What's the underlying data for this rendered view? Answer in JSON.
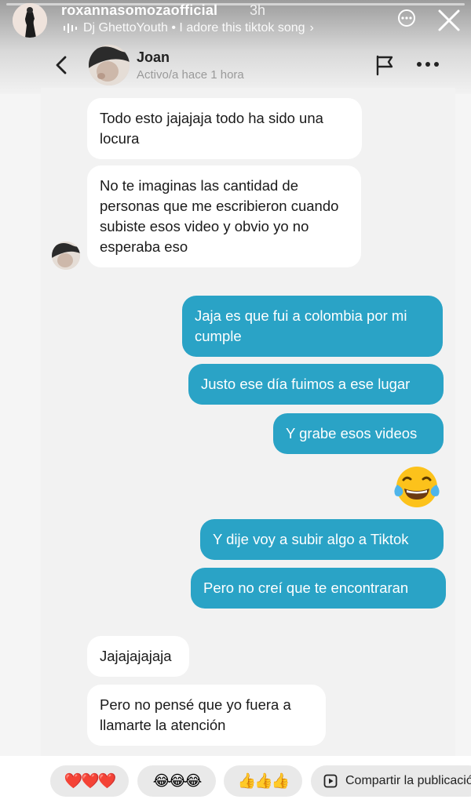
{
  "story": {
    "username": "roxannasomozaofficial",
    "time": "3h",
    "music": "Dj GhettoYouth • I adore this tiktok song",
    "progress": 0.0
  },
  "chat_header": {
    "contact_name": "Joan",
    "contact_status": "Activo/a hace 1 hora"
  },
  "messages": [
    {
      "direction": "in",
      "text": "Todo esto jajajaja todo ha sido una locura"
    },
    {
      "direction": "in",
      "text": "No te imaginas las cantidad de personas que me escribieron cuando subiste esos video y obvio yo no esperaba eso"
    },
    {
      "direction": "out",
      "text": "Jaja es que fui a colombia por mi cumple"
    },
    {
      "direction": "out",
      "text": "Justo ese día fuimos a ese lugar"
    },
    {
      "direction": "out",
      "text": "Y grabe esos videos"
    },
    {
      "direction": "out",
      "text": "😂",
      "type": "emoji",
      "emoji_name": "face-with-tears-of-joy"
    },
    {
      "direction": "out",
      "text": "Y dije voy a subir algo a Tiktok"
    },
    {
      "direction": "out",
      "text": "Pero no creí que te encontraran"
    },
    {
      "direction": "in",
      "text": "Jajajajajaja"
    },
    {
      "direction": "in",
      "text": "Pero no pensé que yo fuera a llamarte la atención"
    }
  ],
  "reactions": {
    "hearts": "❤️❤️❤️",
    "laughs": "😂😂😂",
    "thumbs": "👍👍👍",
    "share_label": "Compartir la publicación"
  },
  "colors": {
    "outgoing_bubble": "#2aa3c6",
    "incoming_bubble": "#ffffff",
    "chat_background": "#f2f2f2"
  }
}
